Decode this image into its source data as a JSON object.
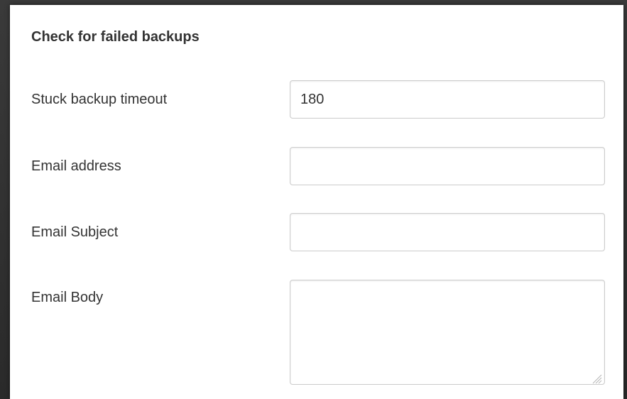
{
  "form": {
    "title": "Check for failed backups",
    "fields": [
      {
        "label": "Stuck backup timeout",
        "value": "180"
      },
      {
        "label": "Email address",
        "value": ""
      },
      {
        "label": "Email Subject",
        "value": ""
      },
      {
        "label": "Email Body",
        "value": ""
      }
    ]
  },
  "icons": {
    "textarea_resize": "resize-grip-icon"
  }
}
